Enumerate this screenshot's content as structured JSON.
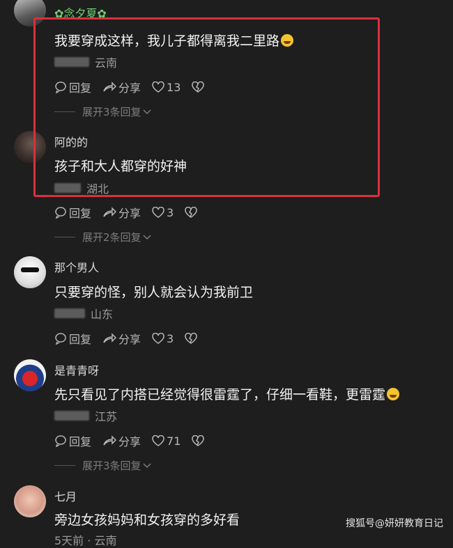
{
  "comments": [
    {
      "username": "✿念夕夏✿",
      "text": "我要穿成这样，我儿子都得离我二里路",
      "has_emoji": true,
      "location": "云南",
      "reply_label": "回复",
      "share_label": "分享",
      "likes": "13",
      "expand_label": "展开3条回复"
    },
    {
      "username": "阿的的",
      "text": "孩子和大人都穿的好神",
      "has_emoji": false,
      "location": "湖北",
      "reply_label": "回复",
      "share_label": "分享",
      "likes": "3",
      "expand_label": "展开2条回复"
    },
    {
      "username": "那个男人",
      "text": "只要穿的怪，别人就会认为我前卫",
      "has_emoji": false,
      "location": "山东",
      "reply_label": "回复",
      "share_label": "分享",
      "likes": "3",
      "expand_label": ""
    },
    {
      "username": "是青青呀",
      "text": "先只看见了内搭已经觉得很雷霆了，仔细一看鞋，更雷霆",
      "has_emoji": true,
      "location": "江苏",
      "reply_label": "回复",
      "share_label": "分享",
      "likes": "71",
      "expand_label": "展开3条回复"
    },
    {
      "username": "七月",
      "text": "旁边女孩妈妈和女孩穿的多好看",
      "has_emoji": false,
      "location": "5天前 · 云南",
      "reply_label": "",
      "share_label": "",
      "likes": "",
      "expand_label": ""
    }
  ],
  "watermark": "搜狐号@妍妍教育日记",
  "colors": {
    "highlight_border": "#d9303e",
    "background": "#1e1e1e"
  }
}
